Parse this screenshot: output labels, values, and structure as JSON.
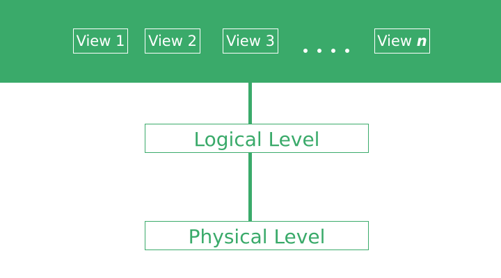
{
  "colors": {
    "accent": "#3aaa6a",
    "on_accent": "#ffffff",
    "background": "#ffffff"
  },
  "views": [
    {
      "label": "View 1"
    },
    {
      "label": "View 2"
    },
    {
      "label": "View 3"
    },
    {
      "label": "View ",
      "suffix": "n"
    }
  ],
  "ellipsis": "....",
  "levels": {
    "logical": "Logical Level",
    "physical": "Physical Level"
  }
}
